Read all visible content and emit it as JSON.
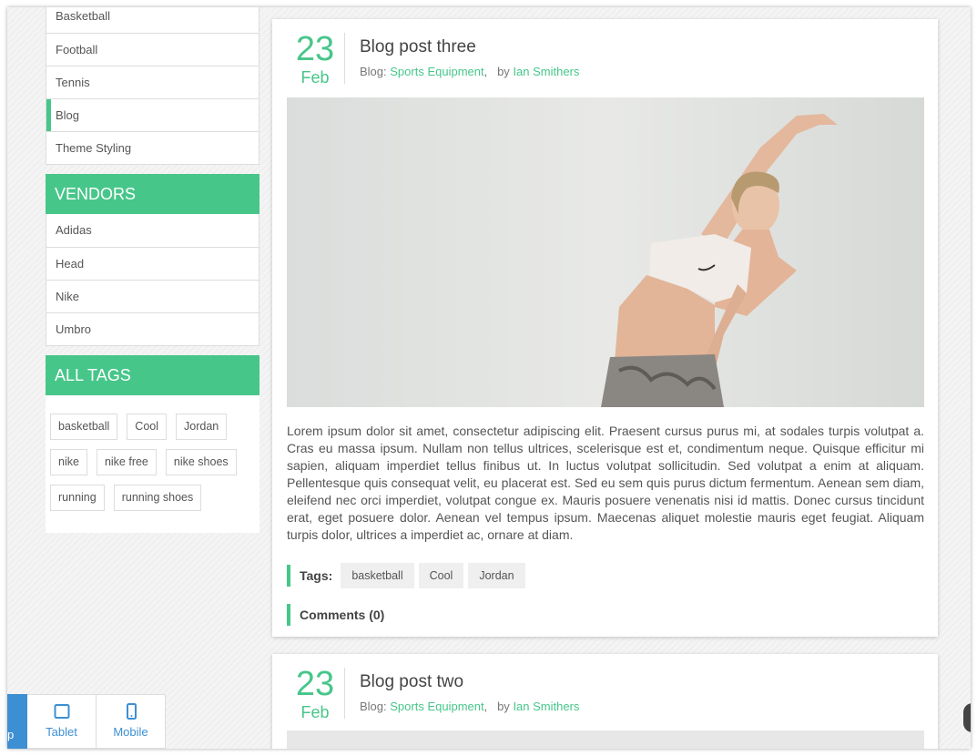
{
  "sidebar": {
    "categories": [
      "Basketball",
      "Football",
      "Tennis",
      "Blog",
      "Theme Styling"
    ],
    "active_category": "Blog",
    "vendors_title": "VENDORS",
    "vendors": [
      "Adidas",
      "Head",
      "Nike",
      "Umbro"
    ],
    "tags_title": "ALL TAGS",
    "tags": [
      "basketball",
      "Cool",
      "Jordan",
      "nike",
      "nike free",
      "nike shoes",
      "running",
      "running shoes"
    ]
  },
  "posts": [
    {
      "day": "23",
      "month": "Feb",
      "title": "Blog post three",
      "blog_prefix": "Blog:",
      "blog_link": "Sports Equipment",
      "sep": ",",
      "by": "by",
      "author": "Ian Smithers",
      "body": "Lorem ipsum dolor sit amet, consectetur adipiscing elit. Praesent cursus purus mi, at sodales turpis volutpat a. Cras eu massa ipsum. Nullam non tellus ultrices, scelerisque est et, condimentum neque. Quisque efficitur mi sapien, aliquam imperdiet tellus finibus ut. In luctus volutpat sollicitudin. Sed volutpat a enim at aliquam. Pellentesque quis consequat velit, eu placerat est. Sed eu sem quis purus dictum fermentum. Aenean sem diam, eleifend nec orci imperdiet, volutpat congue ex. Mauris posuere venenatis nisi id mattis. Donec cursus tincidunt erat, eget posuere dolor. Aenean vel tempus ipsum. Maecenas aliquet molestie mauris eget feugiat. Aliquam turpis dolor, ultrices a imperdiet ac, ornare at diam.",
      "tags_label": "Tags:",
      "tags": [
        "basketball",
        "Cool",
        "Jordan"
      ],
      "comments": "Comments (0)"
    },
    {
      "day": "23",
      "month": "Feb",
      "title": "Blog post two",
      "blog_prefix": "Blog:",
      "blog_link": "Sports Equipment",
      "sep": ",",
      "by": "by",
      "author": "Ian Smithers"
    }
  ],
  "switcher": {
    "desktop_partial": "p",
    "tablet": "Tablet",
    "mobile": "Mobile"
  },
  "colors": {
    "accent": "#47c68a",
    "switcher_blue": "#3d8fd3"
  }
}
